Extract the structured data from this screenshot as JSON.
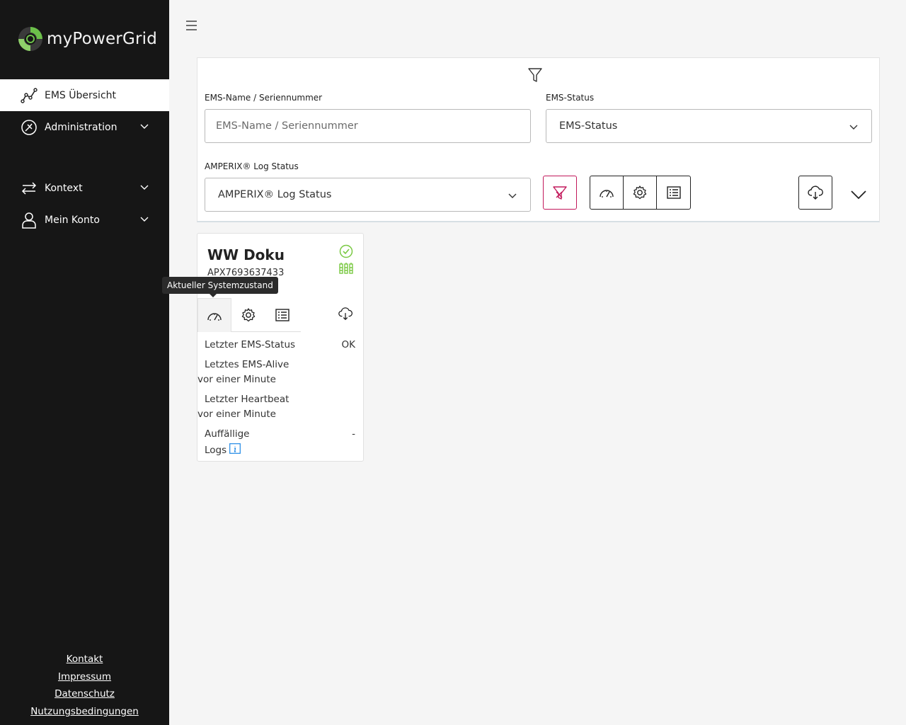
{
  "brand": {
    "name": "myPowerGrid",
    "accent": "#6cc04a"
  },
  "sidebar": {
    "items": [
      {
        "label": "EMS Übersicht",
        "icon": "chart-line-icon",
        "active": true
      },
      {
        "label": "Administration",
        "icon": "admin-icon",
        "expandable": true
      },
      {
        "label": "Kontext",
        "icon": "swap-arrows-icon",
        "expandable": true
      },
      {
        "label": "Mein Konto",
        "icon": "user-icon",
        "expandable": true
      }
    ],
    "footer": [
      "Kontakt",
      "Impressum",
      "Datenschutz",
      "Nutzungsbedingungen"
    ]
  },
  "filters": {
    "name_label": "EMS-Name / Seriennummer",
    "name_placeholder": "EMS-Name / Seriennummer",
    "status_label": "EMS-Status",
    "status_value": "EMS-Status",
    "log_label": "AMPERIX® Log Status",
    "log_value": "AMPERIX® Log Status",
    "clear_color": "#c2185b"
  },
  "tooltip": "Aktueller Systemzustand",
  "card": {
    "title": "WW Doku",
    "serial": "APX7693637433",
    "status_color": "#7ac943",
    "rows": {
      "ems_status_label": "Letzter EMS-Status",
      "ems_status_value": "OK",
      "alive_label": "Letztes EMS-Alive",
      "alive_value": "vor einer Minute",
      "heartbeat_label": "Letzter Heartbeat",
      "heartbeat_value": "vor einer Minute",
      "logs_label_1": "Auffällige",
      "logs_label_2": "Logs",
      "logs_value": "-"
    }
  }
}
